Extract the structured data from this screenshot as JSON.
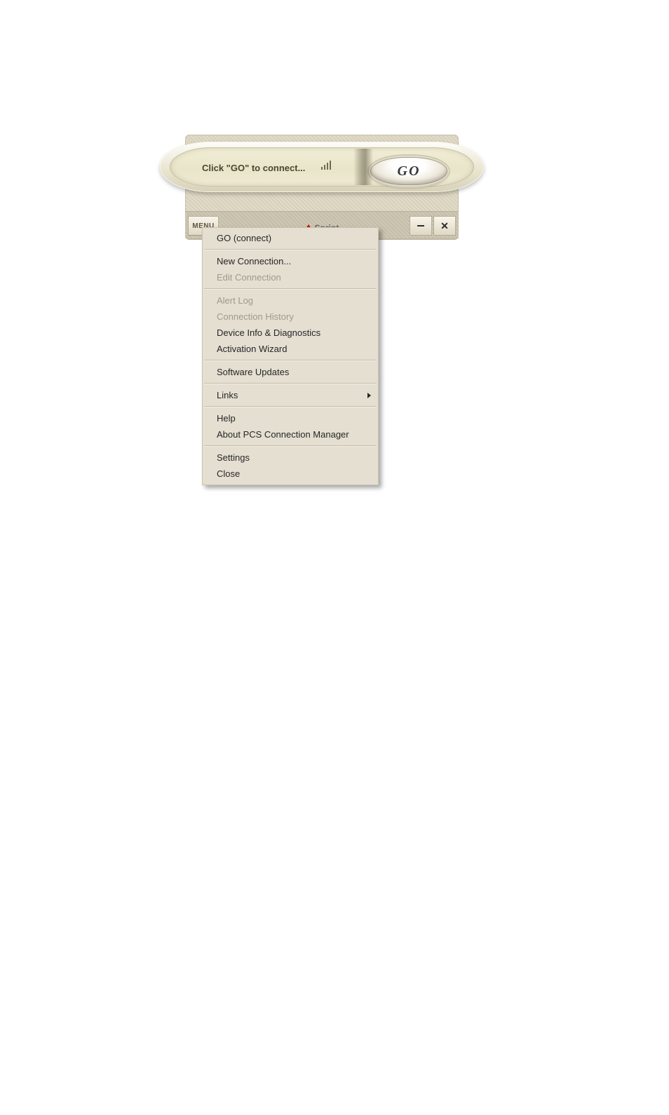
{
  "status_text": "Click \"GO\" to connect...",
  "go_label": "GO",
  "bottom": {
    "menu_label": "MENU",
    "brand": "Sprint"
  },
  "icons": {
    "signal": "signal-icon",
    "minimize": "minimize-icon",
    "close": "close-icon",
    "brand_mark": "sprint-logo-icon",
    "submenu_arrow": "submenu-arrow-icon"
  },
  "menu": [
    {
      "label": "GO (connect)",
      "enabled": true,
      "submenu": false
    },
    {
      "sep": true
    },
    {
      "label": "New Connection...",
      "enabled": true,
      "submenu": false
    },
    {
      "label": "Edit Connection",
      "enabled": false,
      "submenu": false
    },
    {
      "sep": true
    },
    {
      "label": "Alert Log",
      "enabled": false,
      "submenu": false
    },
    {
      "label": "Connection History",
      "enabled": false,
      "submenu": false
    },
    {
      "label": "Device Info & Diagnostics",
      "enabled": true,
      "submenu": false
    },
    {
      "label": "Activation Wizard",
      "enabled": true,
      "submenu": false
    },
    {
      "sep": true
    },
    {
      "label": "Software Updates",
      "enabled": true,
      "submenu": false
    },
    {
      "sep": true
    },
    {
      "label": "Links",
      "enabled": true,
      "submenu": true
    },
    {
      "sep": true
    },
    {
      "label": "Help",
      "enabled": true,
      "submenu": false
    },
    {
      "label": "About PCS Connection Manager",
      "enabled": true,
      "submenu": false
    },
    {
      "sep": true
    },
    {
      "label": "Settings",
      "enabled": true,
      "submenu": false
    },
    {
      "label": "Close",
      "enabled": true,
      "submenu": false
    }
  ]
}
